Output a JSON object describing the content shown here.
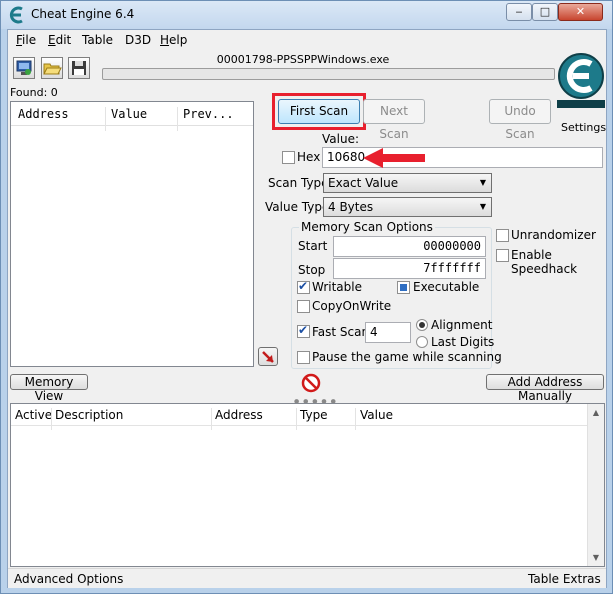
{
  "window": {
    "title": "Cheat Engine 6.4",
    "minimize_glyph": "‒",
    "maximize_glyph": "□",
    "close_glyph": "✕"
  },
  "menu": {
    "file": {
      "mnemonic": "F",
      "rest": "ile"
    },
    "edit": {
      "mnemonic": "E",
      "rest": "dit"
    },
    "table": {
      "mnemonic": "T",
      "rest": "able"
    },
    "d3d": {
      "mnemonic": "D",
      "rest": "3D"
    },
    "help": {
      "mnemonic": "H",
      "rest": "elp"
    }
  },
  "toolbar": {
    "open_process_icon": "computer-process-icon",
    "open_file_icon": "folder-open-icon",
    "save_icon": "floppy-save-icon"
  },
  "process": {
    "name": "00001798-PPSSPPWindows.exe",
    "progress": 0
  },
  "found": "Found: 0",
  "results_columns": [
    "Address",
    "Value",
    "Prev..."
  ],
  "scan": {
    "first_scan": "First Scan",
    "next_scan": "Next Scan",
    "undo_scan": "Undo Scan",
    "settings": "Settings",
    "value_label": "Value:",
    "hex_label": "Hex",
    "hex_checked": false,
    "value": "10680",
    "scan_type_label": "Scan Type",
    "scan_type": "Exact Value",
    "value_type_label": "Value Type",
    "value_type": "4 Bytes"
  },
  "memory_options": {
    "title": "Memory Scan Options",
    "start_label": "Start",
    "start": "00000000",
    "stop_label": "Stop",
    "stop": "7fffffff",
    "writable": "Writable",
    "writable_checked": true,
    "executable": "Executable",
    "executable_state": "indeterminate",
    "copyonwrite": "CopyOnWrite",
    "copyonwrite_checked": false,
    "fast_scan": "Fast Scan",
    "fast_scan_checked": true,
    "fast_scan_value": "4",
    "alignment": "Alignment",
    "last_digits": "Last Digits",
    "alignment_selected": true,
    "pause_game": "Pause the game while scanning",
    "pause_checked": false
  },
  "extra_options": {
    "unrandomizer": "Unrandomizer",
    "speedhack": "Enable Speedhack"
  },
  "buttons": {
    "memory_view": "Memory View",
    "add_address": "Add Address Manually",
    "pointer_arrow_icon": "red-arrow-pointer-icon",
    "stop_icon": "no-entry-icon"
  },
  "address_list_columns": [
    "Active",
    "Description",
    "Address",
    "Type",
    "Value"
  ],
  "status": {
    "advanced_options": "Advanced Options",
    "table_extras": "Table Extras"
  },
  "colors": {
    "annotation_red": "#e8202e",
    "titlebar": "#c3d7ee",
    "logo_teal": "#1d7a8a"
  }
}
